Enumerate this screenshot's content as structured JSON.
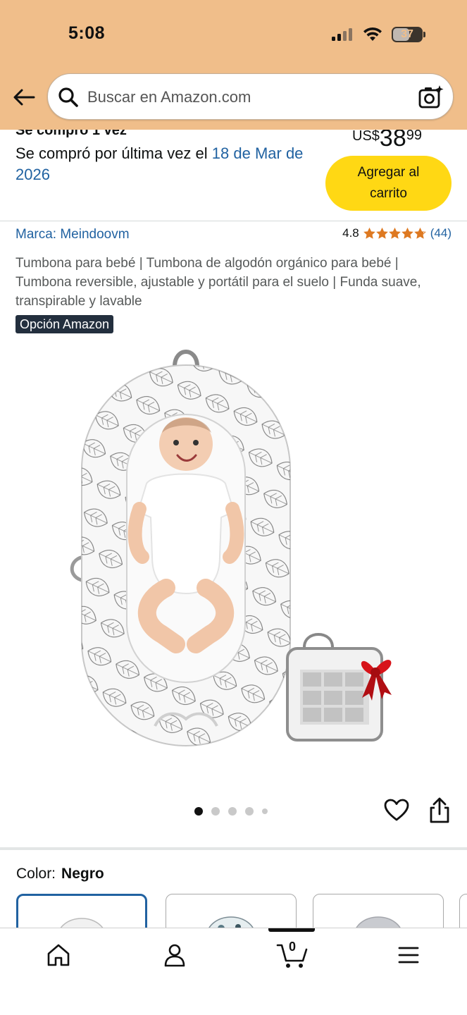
{
  "status_bar": {
    "time": "5:08",
    "battery": "37"
  },
  "search": {
    "placeholder": "Buscar en Amazon.com"
  },
  "purchase": {
    "bought_count": "Se compró 1 vez",
    "bought_last_prefix": "Se compró por última vez el ",
    "bought_last_date": "18 de Mar de 2026",
    "price_currency": "US$",
    "price_whole": "38",
    "price_fraction": "99",
    "add_to_cart_label": "Agregar al carrito"
  },
  "product": {
    "brand": "Marca: Meindoovm",
    "rating": "4.8",
    "rating_stars": 4.8,
    "rating_count": "(44)",
    "title": "Tumbona para bebé | Tumbona de algodón orgánico para bebé | Tumbona reversible, ajustable y portátil para el suelo | Funda suave, transpirable y lavable",
    "badge": "Opción Amazon"
  },
  "carousel": {
    "total": 5,
    "active_index": 0
  },
  "color": {
    "label": "Color:",
    "value": "Negro"
  },
  "bottom_nav": {
    "cart_count": "0"
  },
  "colors": {
    "header_bg": "#f0be8a",
    "link": "#2162a1",
    "cart_button": "#ffd814",
    "star": "#de7921",
    "badge_bg": "#232f3e"
  }
}
